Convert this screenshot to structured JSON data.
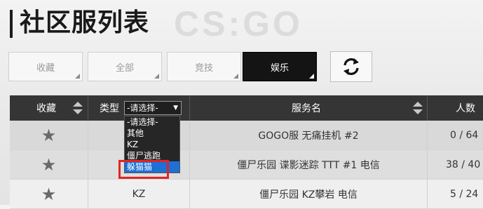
{
  "header": {
    "title": "社区服列表",
    "bg_logo": "CS:GO"
  },
  "tabs": [
    {
      "label": "收藏",
      "active": false
    },
    {
      "label": "全部",
      "active": false
    },
    {
      "label": "竞技",
      "active": false
    },
    {
      "label": "娱乐",
      "active": true
    }
  ],
  "refresh_icon": "refresh-arrows-icon",
  "table": {
    "columns": {
      "fav": "收藏",
      "type": "类型",
      "name": "服务名",
      "players": "人数"
    },
    "type_filter": {
      "selected": "-请选择-",
      "options": [
        "-请选择-",
        "其他",
        "KZ",
        "僵尸逃跑",
        "躲猫猫"
      ],
      "highlighted_option": "躲猫猫"
    },
    "rows": [
      {
        "type": "",
        "name": "GOGO服 无痛挂机 #2",
        "players": "0 / 64"
      },
      {
        "type": "",
        "name": "僵尸乐园 谍影迷踪 TTT #1 电信",
        "players": "38 / 40"
      },
      {
        "type": "KZ",
        "name": "僵尸乐园 KZ攀岩 电信",
        "players": "5 / 24"
      }
    ]
  },
  "colors": {
    "header_bg": "#353535",
    "active_tab_bg": "#141414",
    "dropdown_selection": "#1e6fd6",
    "annotation_box": "#e22424"
  }
}
